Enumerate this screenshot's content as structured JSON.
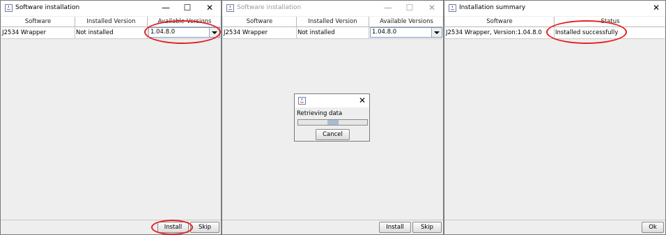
{
  "windows": [
    {
      "title": "Software installation",
      "columns": [
        "Software",
        "Installed Version",
        "Available Versions"
      ],
      "row": {
        "software": "J2534 Wrapper",
        "installed": "Not installed",
        "version": "1.04.8.0"
      },
      "buttons": {
        "install": "Install",
        "skip": "Skip"
      },
      "controls": {
        "minimize": "—",
        "maximize": "☐",
        "close": "✕"
      }
    },
    {
      "title": "Software installation",
      "columns": [
        "Software",
        "Installed Version",
        "Available Versions"
      ],
      "row": {
        "software": "J2534 Wrapper",
        "installed": "Not installed",
        "version": "1.04.8.0"
      },
      "buttons": {
        "install": "Install",
        "skip": "Skip"
      },
      "controls": {
        "minimize": "—",
        "maximize": "☐",
        "close": "✕"
      },
      "dialog": {
        "close": "✕",
        "message": "Retrieving data",
        "progress": 0.5,
        "cancel": "Cancel"
      }
    },
    {
      "title": "Installation summary",
      "columns": [
        "Software",
        "Status"
      ],
      "row": {
        "software": "J2534 Wrapper, Version:1.04.8.0",
        "status": "Installed successfully"
      },
      "buttons": {
        "ok": "Ok"
      },
      "controls": {
        "close": "✕"
      }
    }
  ],
  "colors": {
    "annotation": "#e32020",
    "combo_border": "#7a98c8",
    "progress_fill": "#a8bcd4"
  },
  "icons": {
    "app": "java-app-icon",
    "dropdown": "chevron-down-icon"
  }
}
